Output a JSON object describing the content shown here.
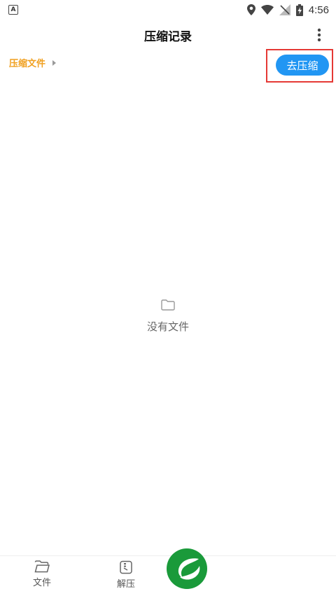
{
  "status_bar": {
    "app_icon_letter": "A",
    "time": "4:56"
  },
  "header": {
    "title": "压缩记录"
  },
  "breadcrumb": {
    "label": "压缩文件"
  },
  "actions": {
    "compress_label": "去压缩"
  },
  "empty_state": {
    "icon": "folder-icon",
    "text": "没有文件"
  },
  "bottom_nav": {
    "items": [
      {
        "label": "文件",
        "icon": "folder-open-icon"
      },
      {
        "label": "解压",
        "icon": "archive-icon"
      }
    ]
  },
  "colors": {
    "accent_blue": "#2196f3",
    "breadcrumb_orange": "#f0a020",
    "highlight_red": "#e53935",
    "logo_green": "#1a9a3a"
  }
}
